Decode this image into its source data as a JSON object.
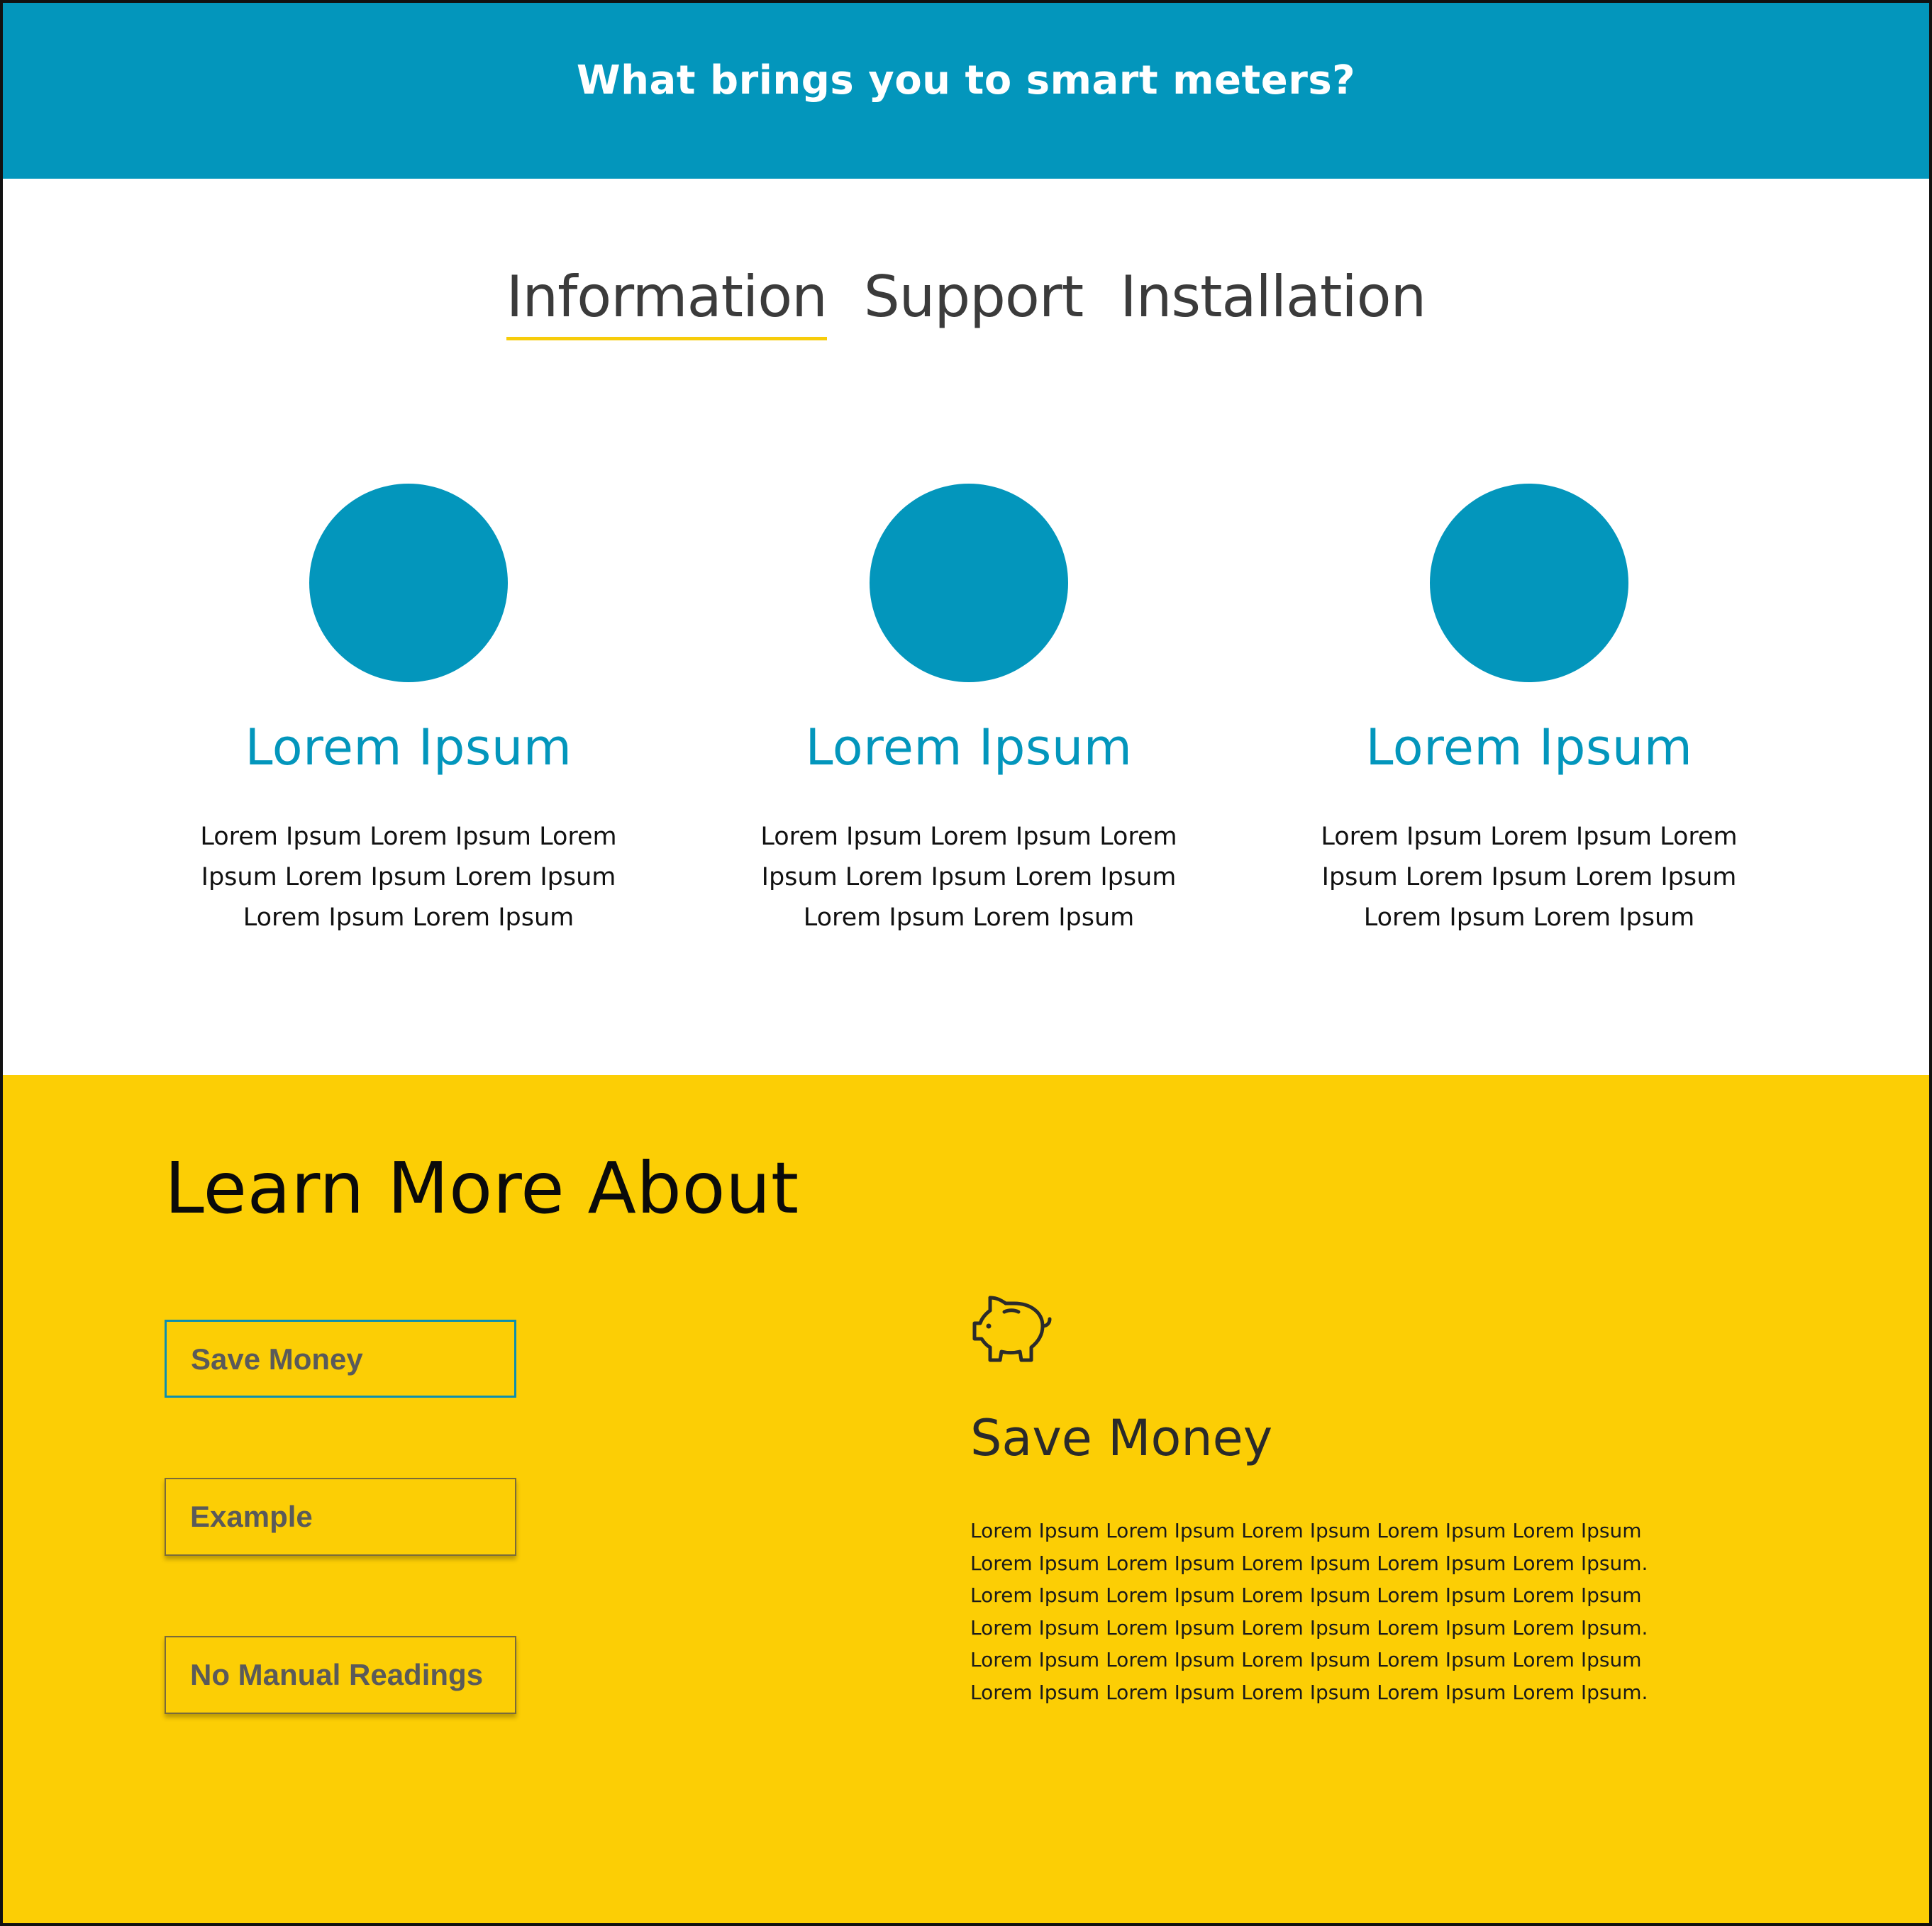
{
  "hero": {
    "title": "What brings you to smart meters?"
  },
  "tabs": [
    {
      "label": "Information",
      "active": true
    },
    {
      "label": "Support",
      "active": false
    },
    {
      "label": "Installation",
      "active": false
    }
  ],
  "features": [
    {
      "title": "Lorem Ipsum",
      "body": "Lorem Ipsum Lorem Ipsum Lorem Ipsum Lorem Ipsum Lorem Ipsum Lorem Ipsum Lorem Ipsum"
    },
    {
      "title": "Lorem Ipsum",
      "body": "Lorem Ipsum Lorem Ipsum Lorem Ipsum Lorem Ipsum Lorem Ipsum Lorem Ipsum Lorem Ipsum"
    },
    {
      "title": "Lorem Ipsum",
      "body": "Lorem Ipsum Lorem Ipsum Lorem Ipsum Lorem Ipsum Lorem Ipsum Lorem Ipsum Lorem Ipsum"
    }
  ],
  "learn": {
    "title": "Learn More About",
    "topics": [
      {
        "label": "Save Money",
        "selected": true
      },
      {
        "label": "Example",
        "selected": false
      },
      {
        "label": "No Manual Readings",
        "selected": false
      }
    ],
    "detail": {
      "icon": "piggy-bank-icon",
      "title": "Save Money",
      "lines": [
        "Lorem Ipsum Lorem Ipsum Lorem Ipsum Lorem Ipsum Lorem Ipsum",
        "Lorem Ipsum Lorem Ipsum Lorem Ipsum Lorem Ipsum Lorem Ipsum.",
        "Lorem Ipsum Lorem Ipsum Lorem Ipsum Lorem Ipsum Lorem Ipsum",
        "Lorem Ipsum Lorem Ipsum Lorem Ipsum Lorem Ipsum Lorem Ipsum.",
        "Lorem Ipsum Lorem Ipsum Lorem Ipsum Lorem Ipsum Lorem Ipsum",
        "Lorem Ipsum Lorem Ipsum Lorem Ipsum Lorem Ipsum Lorem Ipsum."
      ]
    }
  },
  "colors": {
    "primary_blue": "#0396bc",
    "accent_yellow": "#fcce05",
    "tab_underline": "#f7cc0a"
  }
}
